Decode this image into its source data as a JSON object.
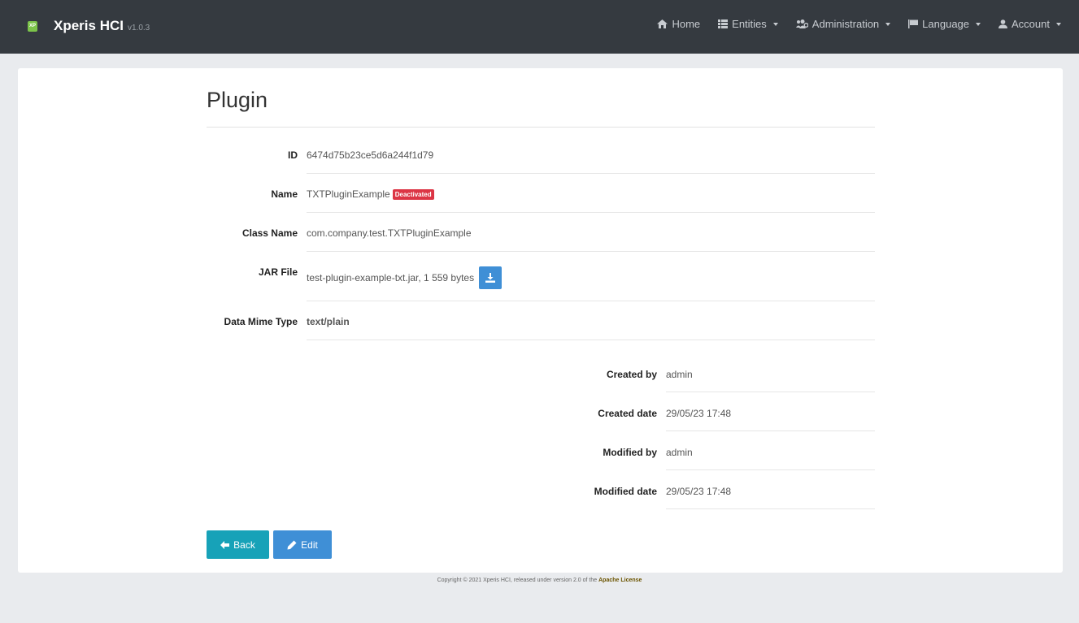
{
  "navbar": {
    "logo_text": "XP",
    "brand": "Xperis HCI",
    "version": "v1.0.3",
    "items": [
      {
        "label": "Home",
        "icon": "home-icon",
        "dropdown": false
      },
      {
        "label": "Entities",
        "icon": "list-icon",
        "dropdown": true
      },
      {
        "label": "Administration",
        "icon": "users-cog-icon",
        "dropdown": true
      },
      {
        "label": "Language",
        "icon": "flag-icon",
        "dropdown": true
      },
      {
        "label": "Account",
        "icon": "user-icon",
        "dropdown": true
      }
    ]
  },
  "page": {
    "title": "Plugin"
  },
  "fields": {
    "id": {
      "label": "ID",
      "value": "6474d75b23ce5d6a244f1d79"
    },
    "name": {
      "label": "Name",
      "value": "TXTPluginExample",
      "badge": "Deactivated"
    },
    "class_name": {
      "label": "Class Name",
      "value": "com.company.test.TXTPluginExample"
    },
    "jar_file": {
      "label": "JAR File",
      "value": "test-plugin-example-txt.jar, 1 559 bytes"
    },
    "mime": {
      "label": "Data Mime Type",
      "value": "text/plain"
    }
  },
  "audit": {
    "created_by": {
      "label": "Created by",
      "value": "admin"
    },
    "created_date": {
      "label": "Created date",
      "value": "29/05/23 17:48"
    },
    "modified_by": {
      "label": "Modified by",
      "value": "admin"
    },
    "modified_date": {
      "label": "Modified date",
      "value": "29/05/23 17:48"
    }
  },
  "actions": {
    "back_label": "Back",
    "edit_label": "Edit"
  },
  "footer": {
    "text": "Copyright © 2021 Xperis HCI, released under version 2.0 of the",
    "link": "Apache License"
  },
  "colors": {
    "navbar": "#353a40",
    "badge": "#dc3545",
    "primary": "#3f8fd6",
    "info": "#17a2b8",
    "accent_text": "#6b5400"
  }
}
